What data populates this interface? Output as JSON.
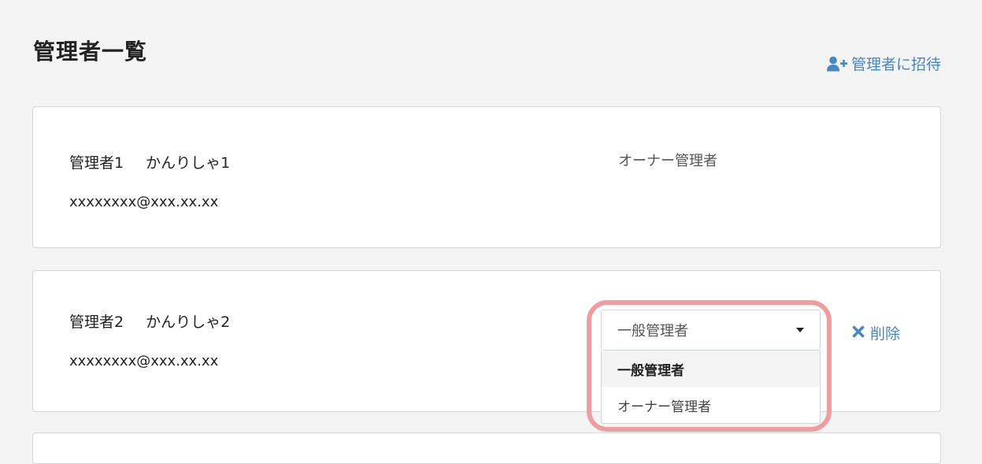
{
  "header": {
    "title": "管理者一覧",
    "invite_label": "管理者に招待",
    "invite_icon": "user-plus-icon"
  },
  "admins": [
    {
      "name": "管理者1",
      "kana": "かんりしゃ1",
      "email": "xxxxxxxx@xxx.xx.xx",
      "role": "オーナー管理者"
    },
    {
      "name": "管理者2",
      "kana": "かんりしゃ2",
      "email": "xxxxxxxx@xxx.xx.xx",
      "role_select": {
        "value": "一般管理者",
        "options": [
          "一般管理者",
          "オーナー管理者"
        ],
        "selected_index": 0,
        "expanded": true
      },
      "delete_label": "削除",
      "delete_icon": "x-icon"
    }
  ],
  "colors": {
    "background": "#f4f4f4",
    "accent": "#4a86c0",
    "highlight": "#ee9ea0",
    "card": "#ffffff"
  }
}
